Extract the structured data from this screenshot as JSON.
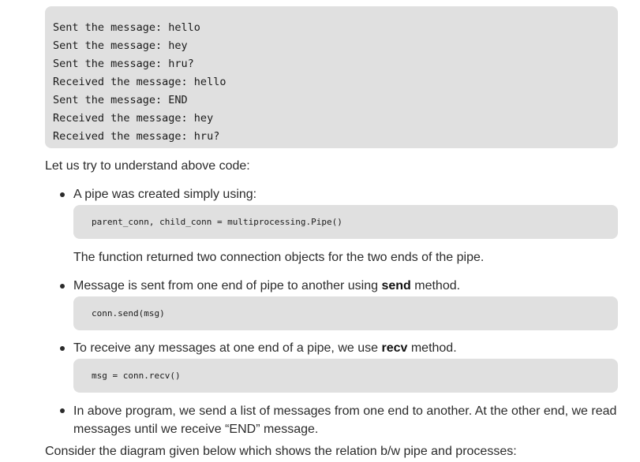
{
  "output": {
    "lines": [
      "Sent the message: hello",
      "Sent the message: hey",
      "Sent the message: hru?",
      "Received the message: hello",
      "Sent the message: END",
      "Received the message: hey",
      "Received the message: hru?"
    ]
  },
  "intro": "Let us try to understand above code:",
  "items": [
    {
      "text": "A pipe was created simply using:",
      "code": "parent_conn, child_conn = multiprocessing.Pipe()",
      "note": "The function returned two connection objects for the two ends of the pipe."
    },
    {
      "text_before": "Message is sent from one end of pipe to another using ",
      "bold": "send",
      "text_after": " method.",
      "code": "conn.send(msg)"
    },
    {
      "text_before": "To receive any messages at one end of a pipe, we use ",
      "bold": "recv",
      "text_after": " method.",
      "code": "msg = conn.recv()"
    },
    {
      "text": "In above program, we send a list of messages from one end to another. At the other end, we read messages until we receive “END” message."
    }
  ],
  "outro": "Consider the diagram given below which shows the relation b/w pipe and processes:"
}
